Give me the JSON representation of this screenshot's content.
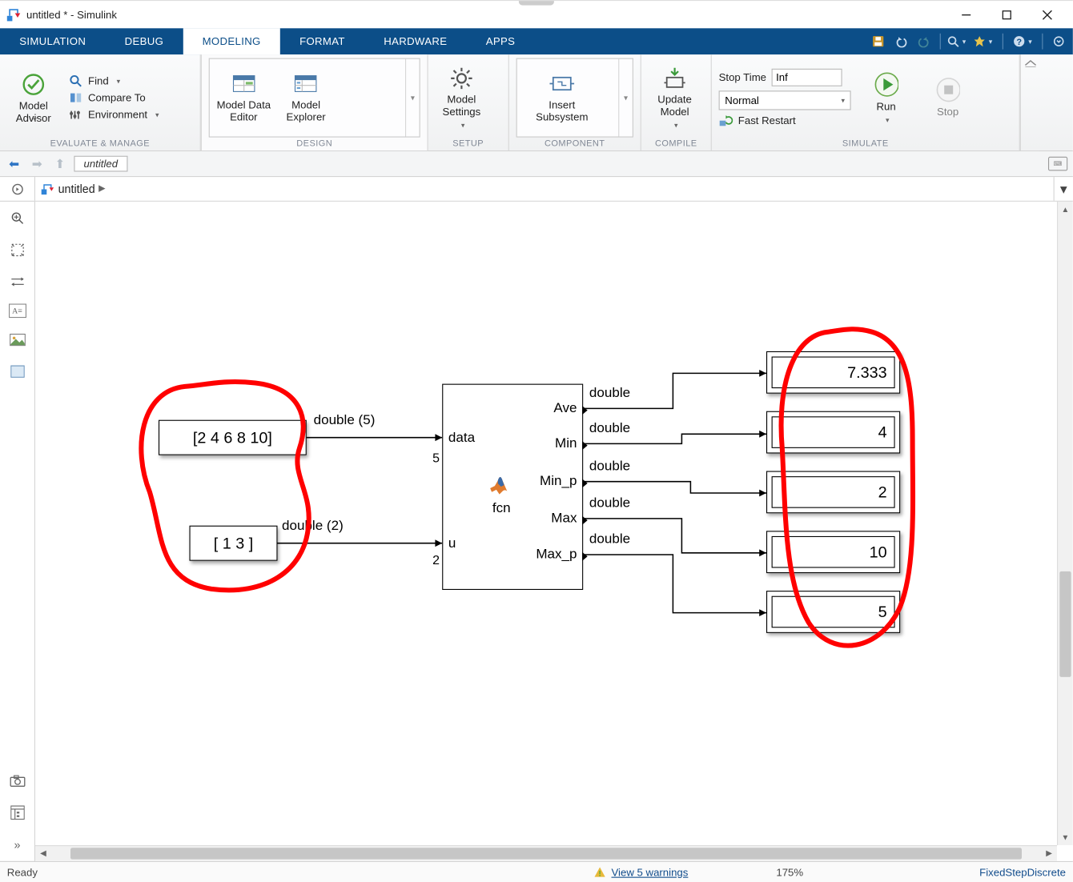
{
  "titlebar": {
    "title": "untitled * - Simulink"
  },
  "ribbon": {
    "tabs": [
      "SIMULATION",
      "DEBUG",
      "MODELING",
      "FORMAT",
      "HARDWARE",
      "APPS"
    ],
    "active_index": 2
  },
  "toolstrip": {
    "evaluate": {
      "model_advisor": "Model\nAdvisor",
      "find": "Find",
      "compare": "Compare To",
      "environment": "Environment",
      "label": "EVALUATE & MANAGE"
    },
    "design": {
      "model_data_editor": "Model Data\nEditor",
      "model_explorer": "Model\nExplorer",
      "label": "DESIGN"
    },
    "setup": {
      "model_settings": "Model\nSettings",
      "label": "SETUP"
    },
    "component": {
      "insert_subsystem": "Insert\nSubsystem",
      "label": "COMPONENT"
    },
    "compile": {
      "update_model": "Update\nModel",
      "label": "COMPILE"
    },
    "simulate": {
      "stop_time_label": "Stop Time",
      "stop_time_value": "Inf",
      "mode": "Normal",
      "fast_restart": "Fast Restart",
      "run": "Run",
      "stop": "Stop",
      "label": "SIMULATE"
    }
  },
  "explorer": {
    "tab": "untitled"
  },
  "breadcrumb": {
    "current": "untitled"
  },
  "canvas": {
    "const1": "[2 4 6 8 10]",
    "const2": "[ 1  3 ]",
    "sig1": "double (5)",
    "sig2": "double (2)",
    "fcn_label": "fcn",
    "ports_in": [
      "data",
      "u"
    ],
    "ports_in_dims": [
      "5",
      "2"
    ],
    "ports_out": [
      "Ave",
      "Min",
      "Min_p",
      "Max",
      "Max_p"
    ],
    "sig_out": [
      "double",
      "double",
      "double",
      "double",
      "double"
    ],
    "displays": [
      "7.333",
      "4",
      "2",
      "10",
      "5"
    ]
  },
  "statusbar": {
    "ready": "Ready",
    "warnings": "View 5 warnings",
    "zoom": "175%",
    "solver": "FixedStepDiscrete"
  }
}
